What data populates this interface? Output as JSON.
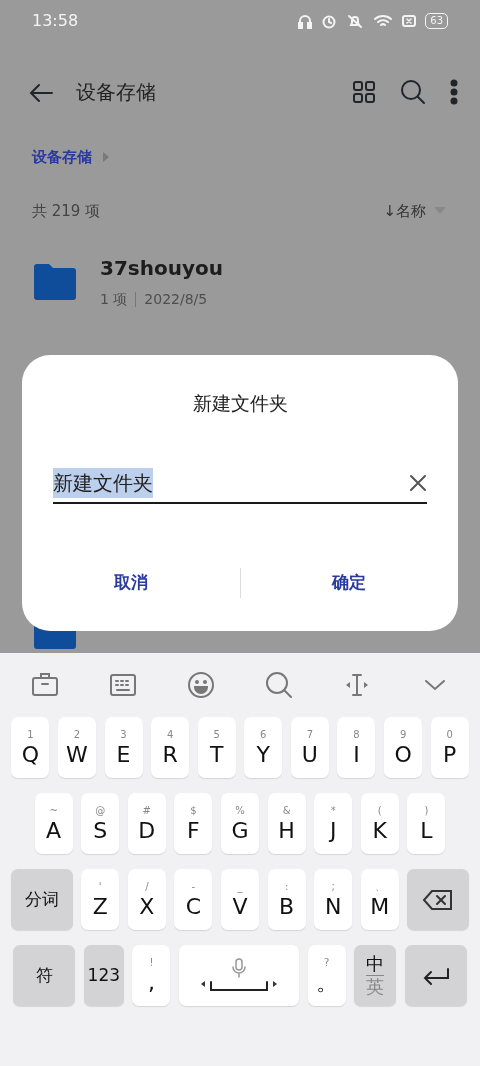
{
  "status_bar": {
    "time": "13:58",
    "battery": "63"
  },
  "app_bar": {
    "title": "设备存储"
  },
  "breadcrumb": [
    "设备存储"
  ],
  "list_header": {
    "count": "共 219 项",
    "sort": "↓名称"
  },
  "files": [
    {
      "kind": "folder",
      "name": "37shouyou",
      "meta": "1 项",
      "date": "2022/8/5"
    },
    {
      "kind": "folder-hidden"
    }
  ],
  "dialog": {
    "title": "新建文件夹",
    "value": "新建文件夹",
    "text_selected": true,
    "buttons": [
      "取消",
      "确定"
    ]
  },
  "keyboard": {
    "rows": [
      {
        "keys": [
          {
            "kind": "letter",
            "sub": "1",
            "main": "Q"
          },
          {
            "kind": "letter",
            "sub": "2",
            "main": "W"
          },
          {
            "kind": "letter",
            "sub": "3",
            "main": "E"
          },
          {
            "kind": "letter",
            "sub": "4",
            "main": "R"
          },
          {
            "kind": "letter",
            "sub": "5",
            "main": "T"
          },
          {
            "kind": "letter",
            "sub": "6",
            "main": "Y"
          },
          {
            "kind": "letter",
            "sub": "7",
            "main": "U"
          },
          {
            "kind": "letter",
            "sub": "8",
            "main": "I"
          },
          {
            "kind": "letter",
            "sub": "9",
            "main": "O"
          },
          {
            "kind": "letter",
            "sub": "0",
            "main": "P"
          }
        ]
      },
      {
        "keys": [
          {
            "kind": "letter",
            "sub": "~",
            "main": "A"
          },
          {
            "kind": "letter",
            "sub": "@",
            "main": "S"
          },
          {
            "kind": "letter",
            "sub": "#",
            "main": "D"
          },
          {
            "kind": "letter",
            "sub": "$",
            "main": "F"
          },
          {
            "kind": "letter",
            "sub": "%",
            "main": "G"
          },
          {
            "kind": "letter",
            "sub": "&",
            "main": "H"
          },
          {
            "kind": "letter",
            "sub": "*",
            "main": "J"
          },
          {
            "kind": "letter",
            "sub": "(",
            "main": "K"
          },
          {
            "kind": "letter",
            "sub": ")",
            "main": "L"
          }
        ]
      },
      {
        "keys": [
          {
            "kind": "function",
            "main": "分词"
          },
          {
            "kind": "letter",
            "sub": "'",
            "main": "Z"
          },
          {
            "kind": "letter",
            "sub": "/",
            "main": "X"
          },
          {
            "kind": "letter",
            "sub": "-",
            "main": "C"
          },
          {
            "kind": "letter",
            "sub": "_",
            "main": "V"
          },
          {
            "kind": "letter",
            "sub": ":",
            "main": "B"
          },
          {
            "kind": "letter",
            "sub": ";",
            "main": "N"
          },
          {
            "kind": "letter",
            "sub": "、",
            "main": "M"
          },
          {
            "kind": "backspace"
          }
        ]
      },
      {
        "keys": [
          {
            "kind": "function",
            "main": "符"
          },
          {
            "kind": "function-narrow",
            "main": "123"
          },
          {
            "kind": "letter",
            "sub": "!",
            "main": ","
          },
          {
            "kind": "space"
          },
          {
            "kind": "letter",
            "sub": "?",
            "main": "。"
          },
          {
            "kind": "lang",
            "main": "中",
            "sub": "英"
          },
          {
            "kind": "enter"
          }
        ]
      }
    ]
  }
}
